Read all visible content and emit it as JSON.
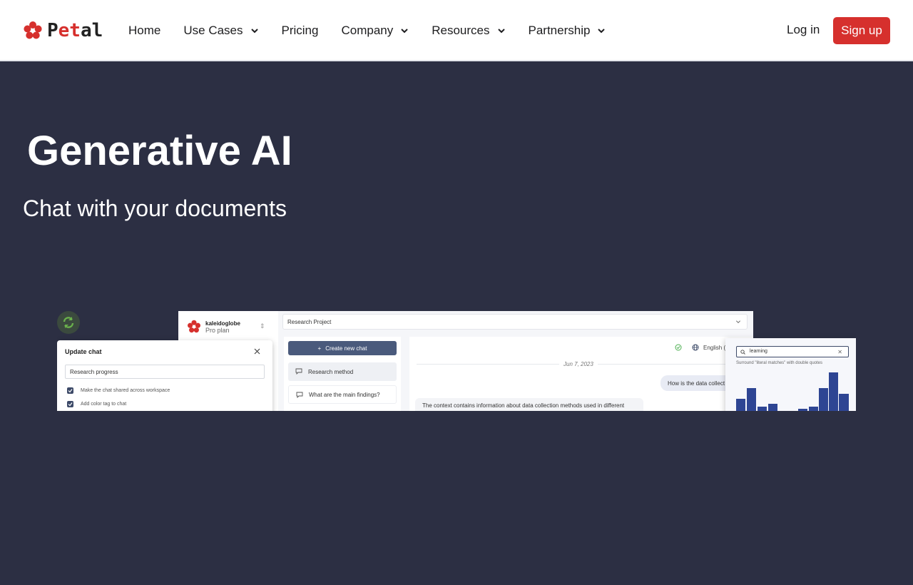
{
  "nav": {
    "brand": {
      "prefix": "P",
      "accent": "et",
      "suffix": "al"
    },
    "links": [
      {
        "label": "Home",
        "dropdown": false
      },
      {
        "label": "Use Cases",
        "dropdown": true
      },
      {
        "label": "Pricing",
        "dropdown": false
      },
      {
        "label": "Company",
        "dropdown": true
      },
      {
        "label": "Resources",
        "dropdown": true
      },
      {
        "label": "Partnership",
        "dropdown": true
      }
    ],
    "login": "Log in",
    "signup": "Sign up"
  },
  "hero": {
    "title": "Generative AI",
    "subtitle": "Chat with your documents"
  },
  "mock": {
    "workspace": {
      "name": "kaleidoglobe",
      "plan": "Pro plan"
    },
    "project": "Research Project",
    "new_chat": "Create new chat",
    "chats": [
      "Research method",
      "What are the main findings?"
    ],
    "language": "English (U",
    "date": "Jun 7, 2023",
    "question": "How is the data collect",
    "answer": "The context contains information about data collection methods used in different",
    "dialog": {
      "title": "Update chat",
      "input_value": "Research progress",
      "options": [
        "Make the chat shared across workspace",
        "Add color tag to chat"
      ]
    },
    "search": {
      "query": "learning",
      "hint": "Surround \"literal matches\" with double quotes"
    }
  },
  "colors": {
    "brand_red": "#d6302d",
    "hero_bg": "#2c2f43",
    "accent_navy": "#2e4593"
  }
}
